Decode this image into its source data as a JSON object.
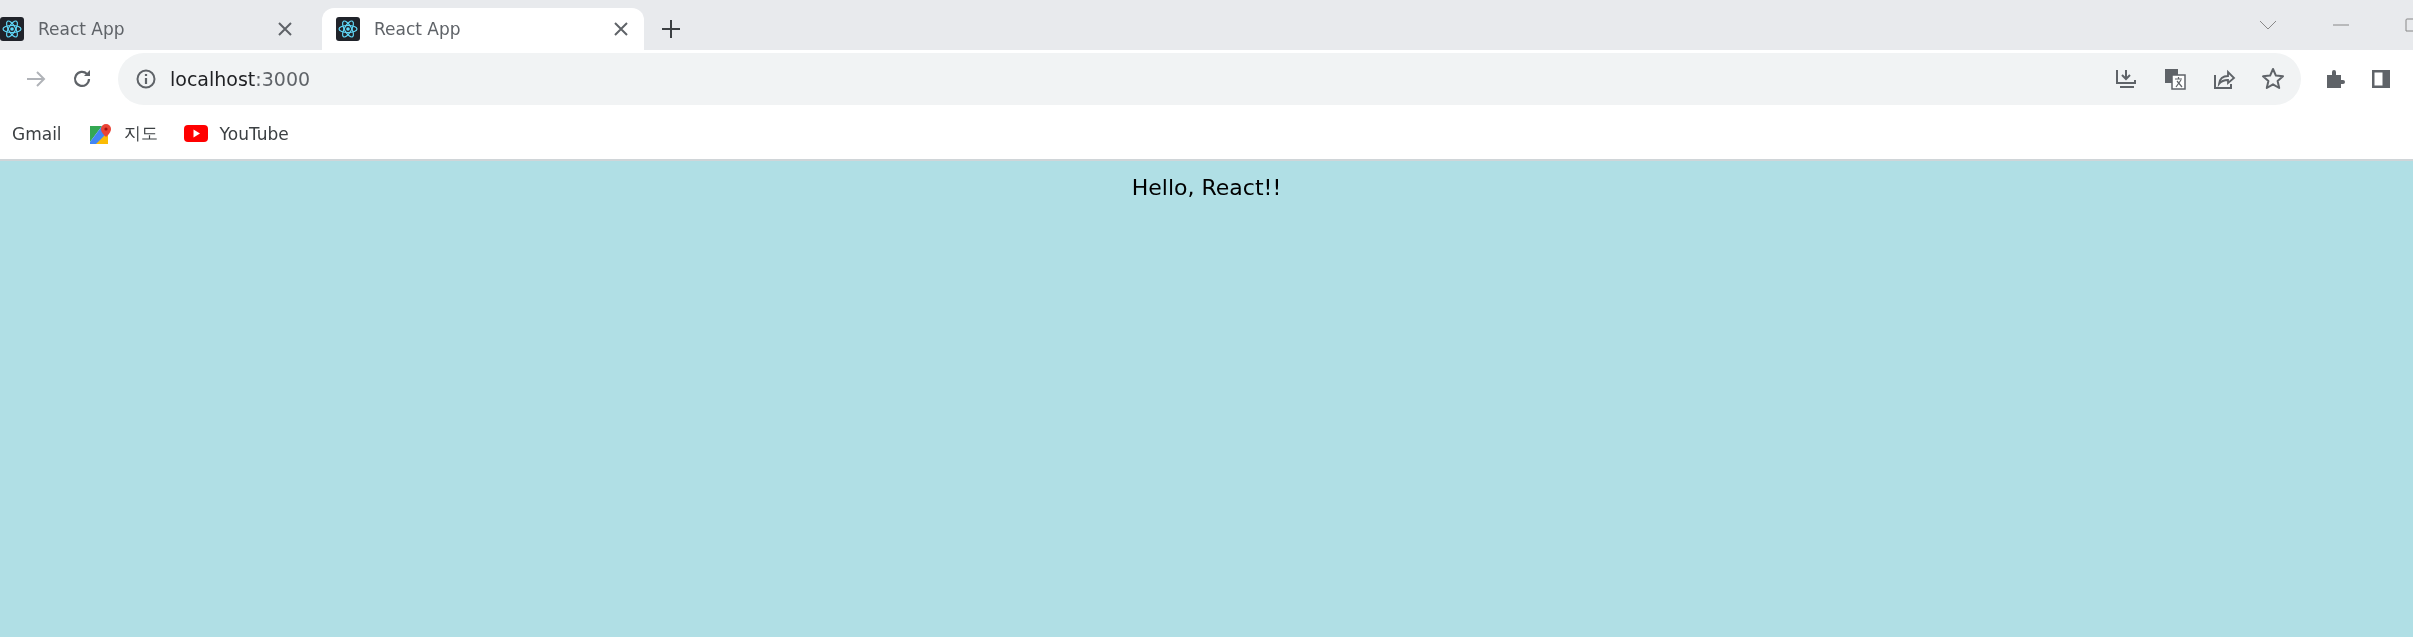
{
  "tabs": [
    {
      "title": "React App",
      "selected": false
    },
    {
      "title": "React App",
      "selected": true
    }
  ],
  "address_bar": {
    "host": "localhost",
    "port": ":3000"
  },
  "bookmarks": [
    {
      "kind": "plain",
      "label": "Gmail"
    },
    {
      "kind": "maps",
      "label": "지도"
    },
    {
      "kind": "video",
      "label": "YouTube"
    }
  ],
  "page": {
    "text": "Hello, React!!"
  }
}
